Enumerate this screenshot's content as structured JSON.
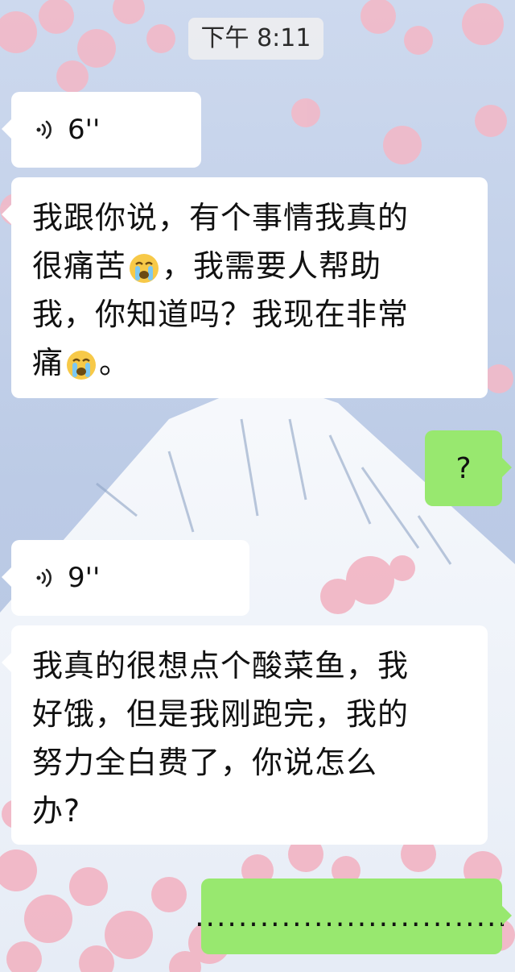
{
  "chat": {
    "timestamp": "下午 8:11",
    "messages": [
      {
        "from": "other",
        "kind": "voice",
        "duration": "6''"
      },
      {
        "from": "other",
        "kind": "text",
        "line1": "我跟你说，有个事情我真的",
        "line2a": "很痛苦",
        "line2b": "，我需要人帮助",
        "line3": "我，你知道吗？我现在非常",
        "line4a": "痛",
        "line4b": "。",
        "emoji": "crying-face-emoji"
      },
      {
        "from": "me",
        "kind": "text",
        "text": "?"
      },
      {
        "from": "other",
        "kind": "voice",
        "duration": "9''"
      },
      {
        "from": "other",
        "kind": "text",
        "line1": "我真的很想点个酸菜鱼，我",
        "line2": "好饿，但是我刚跑完，我的",
        "line3": "努力全白费了，你说怎么",
        "line4": "办?"
      },
      {
        "from": "me",
        "kind": "text",
        "text": "............................."
      }
    ]
  },
  "colors": {
    "incoming_bubble": "#ffffff",
    "outgoing_bubble": "#98e86f",
    "wallpaper_sky": "#b9c9e4",
    "wallpaper_snow": "#eef2f8",
    "blossom": "#f4b7c6"
  },
  "icons": {
    "voice": "voice-wave-icon"
  }
}
